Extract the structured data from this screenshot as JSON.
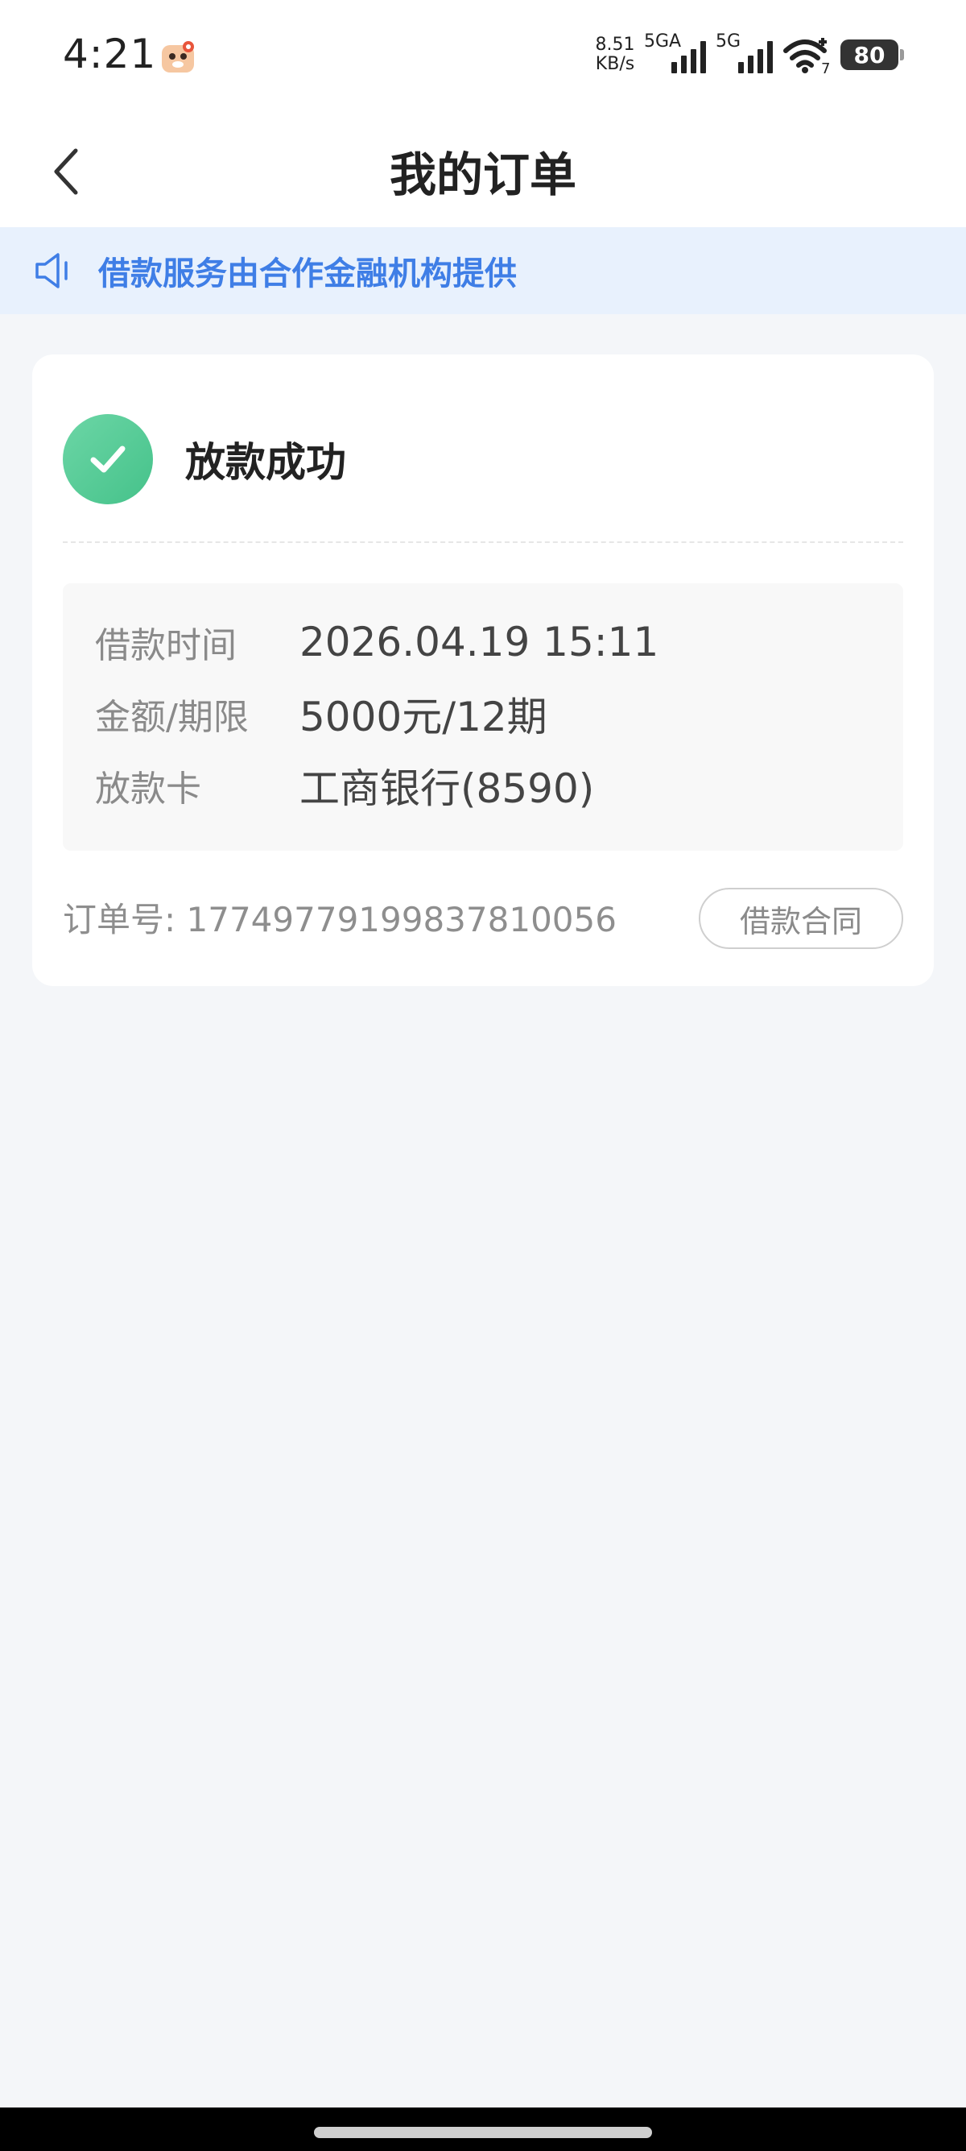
{
  "status_bar": {
    "time": "4:21",
    "net_speed_value": "8.51",
    "net_speed_unit": "KB/s",
    "sim1_label": "5GA",
    "sim2_label": "5G",
    "wifi_badge": "7",
    "battery": "80",
    "icons": [
      "app-mascot-icon",
      "signal-icon",
      "wifi-icon",
      "battery-icon"
    ]
  },
  "header": {
    "title": "我的订单",
    "back_icon": "chevron-left-icon"
  },
  "notice": {
    "text": "借款服务由合作金融机构提供",
    "icon": "speaker-icon",
    "color": "#3f7ee6"
  },
  "order": {
    "status": "放款成功",
    "status_icon": "check-circle-icon",
    "status_color": "#4fc994",
    "details": [
      {
        "label": "借款时间",
        "value": "2026.04.19 15:11"
      },
      {
        "label": "金额/期限",
        "value": "5000元/12期"
      },
      {
        "label": "放款卡",
        "value": "工商银行(8590)"
      }
    ],
    "order_no_label": "订单号:",
    "order_no": "17749779199837810056",
    "contract_button": "借款合同"
  }
}
